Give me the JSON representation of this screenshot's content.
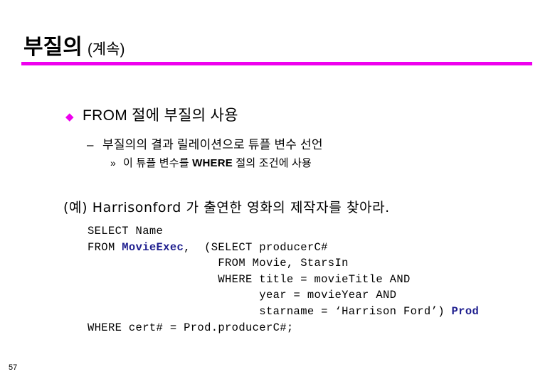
{
  "slide": {
    "title_main": "부질의",
    "title_sub": "(계속)",
    "rule_color": "#ee00ee",
    "page_number": "57"
  },
  "bullets": {
    "level1": {
      "marker": "diamond-bullet",
      "marker_glyph": "◆",
      "text": "FROM 절에 부질의 사용"
    },
    "level2": {
      "marker": "dash-bullet",
      "marker_glyph": "–",
      "text": "부질의의 결과 릴레이션으로 튜플 변수 선언"
    },
    "level3": {
      "marker": "double-angle-bullet",
      "marker_glyph": "»",
      "text_before": "이 튜플 변수를 ",
      "text_bold": "WHERE",
      "text_after": " 절의 조건에 사용"
    }
  },
  "example": {
    "caption": "(예) Harrisonford 가 출연한 영화의 제작자를 찾아라."
  },
  "sql": {
    "accent_color": "#1f1f8f",
    "lines": [
      [
        {
          "t": "SELECT Name",
          "b": false
        }
      ],
      [
        {
          "t": "FROM ",
          "b": false
        },
        {
          "t": "MovieExec",
          "b": true
        },
        {
          "t": ",  (SELECT producerC#",
          "b": false
        }
      ],
      [
        {
          "t": "                   FROM Movie, StarsIn",
          "b": false
        }
      ],
      [
        {
          "t": "                   WHERE title = movieTitle AND",
          "b": false
        }
      ],
      [
        {
          "t": "                         year = movieYear AND",
          "b": false
        }
      ],
      [
        {
          "t": "                         starname = ‘Harrison Ford’) ",
          "b": false
        },
        {
          "t": "Prod",
          "b": true
        }
      ],
      [
        {
          "t": "WHERE cert# = Prod.producerC#;",
          "b": false
        }
      ]
    ]
  }
}
